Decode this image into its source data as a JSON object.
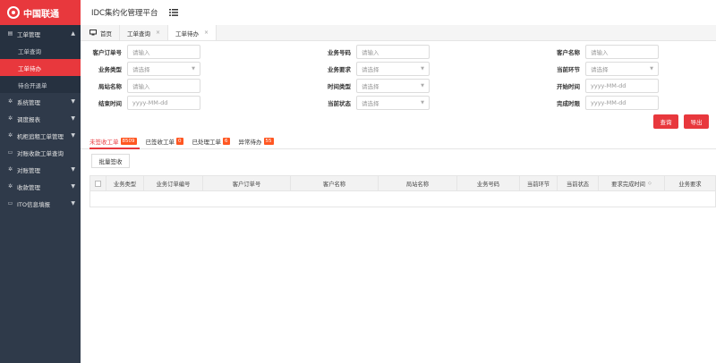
{
  "brand": {
    "name": "中国联通"
  },
  "header": {
    "title": "IDC集约化管理平台",
    "menu_icon": "list-icon"
  },
  "sidebar": {
    "items": [
      {
        "label": "工单管理",
        "icon": "folder-icon",
        "open": true
      },
      {
        "label": "工单查询",
        "sub": true
      },
      {
        "label": "工单待办",
        "sub": true,
        "active": true
      },
      {
        "label": "待合开退单",
        "sub": true
      },
      {
        "label": "系统管理",
        "icon": "gear-icon"
      },
      {
        "label": "调度报表",
        "icon": "gear-icon"
      },
      {
        "label": "机柜追租工单管理",
        "icon": "gear-icon"
      },
      {
        "label": "对账收款工单查询",
        "icon": "doc-icon"
      },
      {
        "label": "对账管理",
        "icon": "gear-icon"
      },
      {
        "label": "收款管理",
        "icon": "gear-icon"
      },
      {
        "label": "ITO信息填报",
        "icon": "doc-icon"
      }
    ]
  },
  "tabs": [
    {
      "label": "首页",
      "icon": "monitor-icon"
    },
    {
      "label": "工单查询",
      "close": "×"
    },
    {
      "label": "工单待办",
      "close": "×",
      "active": true
    }
  ],
  "form": {
    "customer_order_no": {
      "label": "客户订单号",
      "placeholder": "请输入"
    },
    "business_no": {
      "label": "业务号码",
      "placeholder": "请输入"
    },
    "customer_name": {
      "label": "客户名称",
      "placeholder": "请输入"
    },
    "business_type": {
      "label": "业务类型",
      "placeholder": "请选择"
    },
    "business_req": {
      "label": "业务要求",
      "placeholder": "请选择"
    },
    "current_stage": {
      "label": "当前环节",
      "placeholder": "请选择"
    },
    "site_name": {
      "label": "局站名称",
      "placeholder": "请输入"
    },
    "time_type": {
      "label": "时间类型",
      "placeholder": "请选择"
    },
    "start_time": {
      "label": "开始时间",
      "placeholder": "yyyy-MM-dd"
    },
    "end_time": {
      "label": "结束时间",
      "placeholder": "yyyy-MM-dd"
    },
    "current_status": {
      "label": "当前状态",
      "placeholder": "请选择"
    },
    "deadline": {
      "label": "完成时限",
      "placeholder": "yyyy-MM-dd"
    }
  },
  "buttons": {
    "query": "查询",
    "export": "导出",
    "batch_sign": "批量签收"
  },
  "status_tabs": [
    {
      "label": "未签收工单",
      "count": "8509",
      "active": true
    },
    {
      "label": "已签收工单",
      "count": "0"
    },
    {
      "label": "已处理工单",
      "count": "6"
    },
    {
      "label": "异常待办",
      "count": "55"
    }
  ],
  "table": {
    "columns": [
      "业务类型",
      "业务订单编号",
      "客户订单号",
      "客户名称",
      "局站名称",
      "业务号码",
      "当前环节",
      "当前状态",
      "要求完成时间",
      "业务要求"
    ],
    "sort_icon": "◇"
  },
  "colors": {
    "accent": "#e8383d",
    "sidebar": "#2f3a4a",
    "badge": "#ff5722"
  }
}
